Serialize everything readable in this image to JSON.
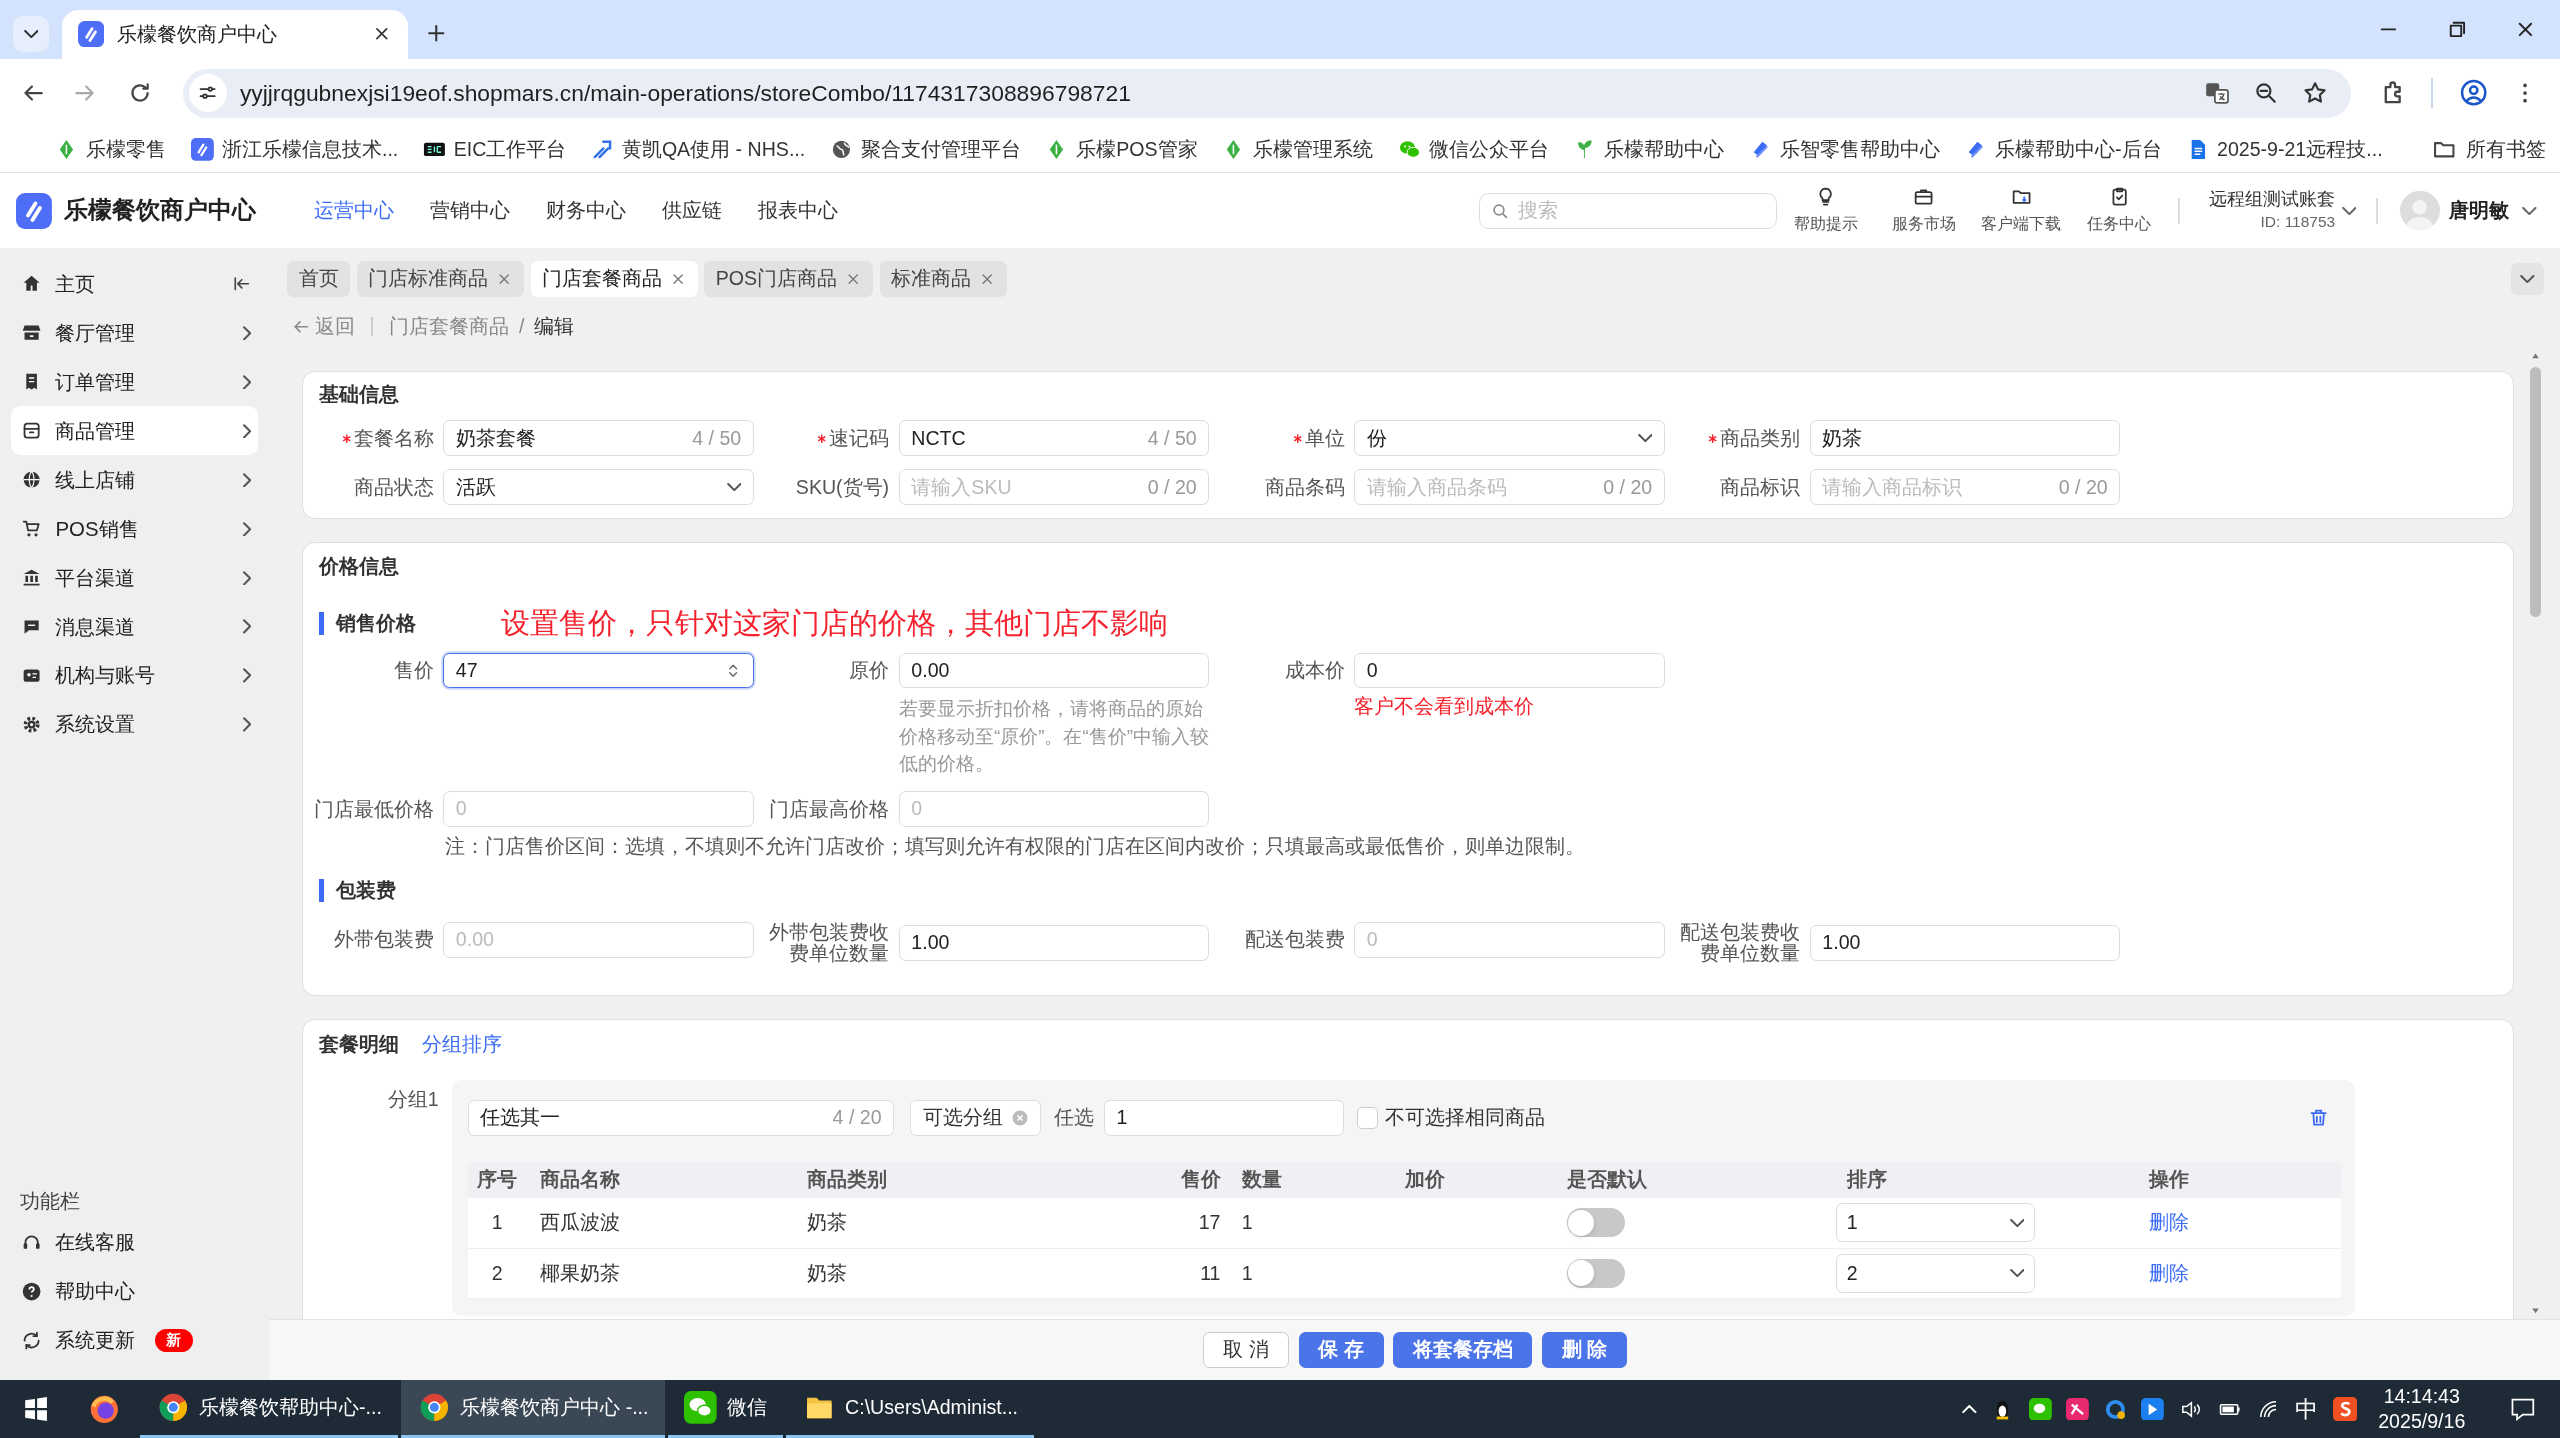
{
  "browser": {
    "tab": {
      "title": "乐檬餐饮商户中心"
    },
    "url": "yyjjrqgubnexjsi19eof.shopmars.cn/main-operations/storeCombo/1174317308896798721",
    "bookmarks": [
      {
        "label": "乐檬零售",
        "kind": "leaf"
      },
      {
        "label": "浙江乐檬信息技术...",
        "kind": "app"
      },
      {
        "label": "EIC工作平台",
        "kind": "card"
      },
      {
        "label": "黄凯QA使用 - NHS...",
        "kind": "arrows"
      },
      {
        "label": "聚合支付管理平台",
        "kind": "globe"
      },
      {
        "label": "乐檬POS管家",
        "kind": "leaf"
      },
      {
        "label": "乐檬管理系统",
        "kind": "leaf"
      },
      {
        "label": "微信公众平台",
        "kind": "chat"
      },
      {
        "label": "乐檬帮助中心",
        "kind": "sprout"
      },
      {
        "label": "乐智零售帮助中心",
        "kind": "logo"
      },
      {
        "label": "乐檬帮助中心-后台",
        "kind": "logo"
      },
      {
        "label": "2025-9-21远程技...",
        "kind": "doc"
      }
    ],
    "all_bookmarks": "所有书签"
  },
  "header": {
    "title": "乐檬餐饮商户中心",
    "nav": [
      {
        "label": "运营中心",
        "selected": true
      },
      {
        "label": "营销中心",
        "selected": false
      },
      {
        "label": "财务中心",
        "selected": false
      },
      {
        "label": "供应链",
        "selected": false
      },
      {
        "label": "报表中心",
        "selected": false
      }
    ],
    "search": {
      "placeholder": "搜索"
    },
    "tools": [
      {
        "label": "帮助提示",
        "kind": "bulb"
      },
      {
        "label": "服务市场",
        "kind": "bag"
      },
      {
        "label": "客户端下载",
        "kind": "folder"
      },
      {
        "label": "任务中心",
        "kind": "clipboard"
      }
    ],
    "account": {
      "name": "远程组测试账套",
      "id": "ID: 118753"
    },
    "user": {
      "name": "唐明敏"
    }
  },
  "sidebar": {
    "items": [
      {
        "label": "主页",
        "kind": "home",
        "selected": false
      },
      {
        "label": "餐厅管理",
        "kind": "store",
        "selected": false
      },
      {
        "label": "订单管理",
        "kind": "receipt",
        "selected": false
      },
      {
        "label": "商品管理",
        "kind": "box",
        "selected": true
      },
      {
        "label": "线上店铺",
        "kind": "globe",
        "selected": false
      },
      {
        "label": "POS销售",
        "kind": "cart",
        "selected": false
      },
      {
        "label": "平台渠道",
        "kind": "bank",
        "selected": false
      },
      {
        "label": "消息渠道",
        "kind": "chat",
        "selected": false
      },
      {
        "label": "机构与账号",
        "kind": "idcard",
        "selected": false
      },
      {
        "label": "系统设置",
        "kind": "gear",
        "selected": false
      }
    ],
    "section_title": "功能栏",
    "tools": [
      {
        "label": "在线客服",
        "kind": "headset"
      },
      {
        "label": "帮助中心",
        "kind": "help"
      },
      {
        "label": "系统更新",
        "kind": "refresh",
        "badge": "新"
      }
    ]
  },
  "page_tabs": [
    {
      "label": "首页",
      "closable": false,
      "selected": false
    },
    {
      "label": "门店标准商品",
      "closable": true,
      "selected": false
    },
    {
      "label": "门店套餐商品",
      "closable": true,
      "selected": true
    },
    {
      "label": "POS门店商品",
      "closable": true,
      "selected": false
    },
    {
      "label": "标准商品",
      "closable": true,
      "selected": false
    }
  ],
  "breadcrumb": {
    "back": "返回",
    "path": [
      "门店套餐商品",
      "编辑"
    ],
    "separator": "/"
  },
  "basic_info": {
    "title": "基础信息",
    "fields": [
      {
        "label": "套餐名称",
        "required": true,
        "kind": "text",
        "value": "奶茶套餐",
        "count": "4 / 50"
      },
      {
        "label": "速记码",
        "required": true,
        "kind": "text",
        "value": "NCTC",
        "count": "4 / 50"
      },
      {
        "label": "单位",
        "required": true,
        "kind": "select",
        "value": "份"
      },
      {
        "label": "商品类别",
        "required": true,
        "kind": "text",
        "value": "奶茶"
      },
      {
        "label": "商品状态",
        "required": false,
        "kind": "select",
        "value": "活跃"
      },
      {
        "label": "SKU(货号)",
        "required": false,
        "kind": "text",
        "placeholder": "请输入SKU",
        "count": "0 / 20"
      },
      {
        "label": "商品条码",
        "required": false,
        "kind": "text",
        "placeholder": "请输入商品条码",
        "count": "0 / 20"
      },
      {
        "label": "商品标识",
        "required": false,
        "kind": "text",
        "placeholder": "请输入商品标识",
        "count": "0 / 20"
      }
    ]
  },
  "price_info": {
    "title": "价格信息",
    "sale_title": "销售价格",
    "annotation": "设置售价，只针对这家门店的价格，其他门店不影响",
    "sale_fields": [
      {
        "label": "售价",
        "kind": "number",
        "value": "47",
        "focused": true
      },
      {
        "label": "原价",
        "kind": "text",
        "value": "0.00",
        "focused": false,
        "hint": "若要显示折扣价格，请将商品的原始价格移动至“原价”。在“售价”中输入较低的价格。"
      },
      {
        "label": "成本价",
        "kind": "text",
        "value": "0",
        "focused": false,
        "warning": "客户不会看到成本价"
      }
    ],
    "range_fields": [
      {
        "label": "门店最低价格",
        "placeholder": "0"
      },
      {
        "label": "门店最高价格",
        "placeholder": "0"
      }
    ],
    "note": "注：门店售价区间：选填，不填则不允许门店改价；填写则允许有权限的门店在区间内改价；只填最高或最低售价，则单边限制。",
    "packaging_title": "包装费",
    "packaging_fields": [
      {
        "label": "外带包装费",
        "placeholder": "0.00"
      },
      {
        "label": "外带包装费收费单位数量",
        "value": "1.00"
      },
      {
        "label": "配送包装费",
        "placeholder": "0"
      },
      {
        "label": "配送包装费收费单位数量",
        "value": "1.00"
      }
    ]
  },
  "combo": {
    "title": "套餐明细",
    "sort_link": "分组排序",
    "groups": [
      {
        "label": "分组1",
        "name": "任选其一",
        "count": "4 / 20",
        "tag": "可选分组",
        "choose_label": "任选",
        "choose_value": "1",
        "no_duplicate": {
          "label": "不可选择相同商品",
          "checked": false
        },
        "columns": [
          "序号",
          "商品名称",
          "商品类别",
          "售价",
          "数量",
          "加价",
          "是否默认",
          "排序",
          "操作"
        ],
        "rows": [
          {
            "index": "1",
            "name": "西瓜波波",
            "category": "奶茶",
            "price": "17",
            "qty": "1",
            "default": false,
            "order": "1",
            "action": "删除"
          },
          {
            "index": "2",
            "name": "椰果奶茶",
            "category": "奶茶",
            "price": "11",
            "qty": "1",
            "default": false,
            "order": "2",
            "action": "删除"
          }
        ]
      }
    ]
  },
  "footer": {
    "buttons": [
      {
        "label": "取 消",
        "kind": "secondary"
      },
      {
        "label": "保 存",
        "kind": "primary"
      },
      {
        "label": "将套餐存档",
        "kind": "primary"
      },
      {
        "label": "删 除",
        "kind": "primary"
      }
    ]
  },
  "taskbar": {
    "apps": [
      {
        "kind": "firefox",
        "selected": false
      },
      {
        "kind": "chrome",
        "label": "乐檬餐饮帮助中心-...",
        "selected": false
      },
      {
        "kind": "chrome",
        "label": "乐檬餐饮商户中心 -...",
        "selected": true
      },
      {
        "kind": "wechat",
        "label": "微信",
        "selected": false
      },
      {
        "kind": "folder",
        "label": "C:\\Users\\Administ...",
        "selected": false
      }
    ],
    "ime": "中",
    "time": "14:14:43",
    "date": "2025/9/16"
  }
}
